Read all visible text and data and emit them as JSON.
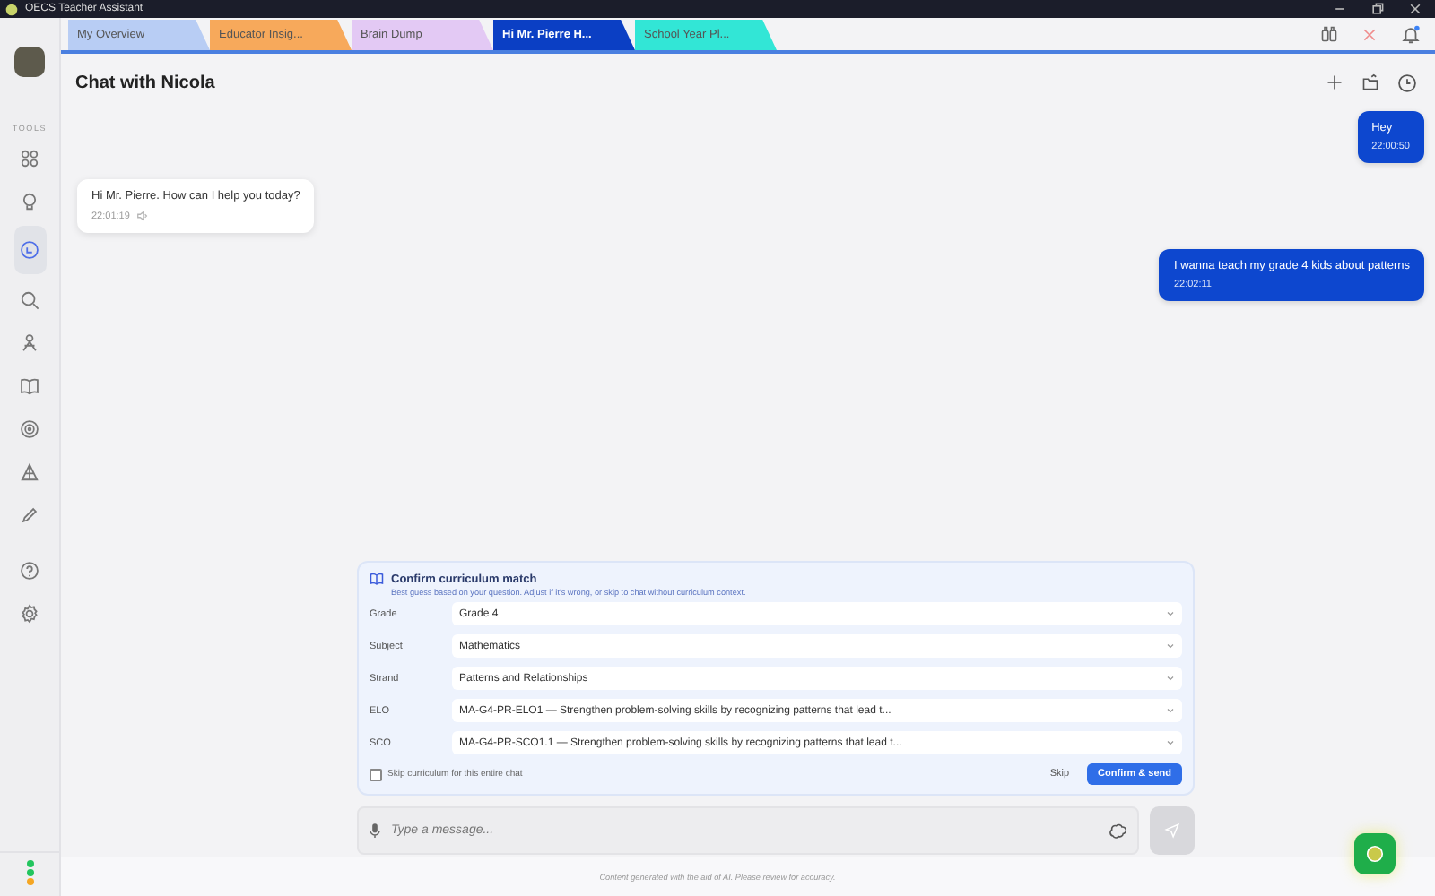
{
  "window": {
    "title": "OECS Teacher Assistant"
  },
  "tabs": [
    {
      "label": "My Overview",
      "selected": false,
      "color": "#b8cdf4"
    },
    {
      "label": "Educator Insig...",
      "selected": false,
      "color": "#f7a95b"
    },
    {
      "label": "Brain Dump",
      "selected": false,
      "color": "#e3c9f4"
    },
    {
      "label": "Hi Mr. Pierre H...",
      "selected": true,
      "color": "#0b3fc4"
    },
    {
      "label": "School Year Pl...",
      "selected": false,
      "color": "#32e6d6"
    }
  ],
  "sidebar": {
    "section_label": "TOOLS",
    "items": [
      {
        "selected": false
      },
      {
        "selected": false
      },
      {
        "selected": true
      },
      {
        "selected": false
      },
      {
        "selected": false
      },
      {
        "selected": false
      },
      {
        "selected": false
      },
      {
        "selected": false
      },
      {
        "selected": false
      },
      {
        "selected": false
      },
      {
        "selected": false
      }
    ],
    "status_dots": [
      {
        "color": "#22c55e"
      },
      {
        "color": "#22c55e"
      },
      {
        "color": "#f5a623"
      }
    ]
  },
  "chat": {
    "title": "Chat with Nicola",
    "messages": [
      {
        "kind": "user",
        "text": "Hey",
        "time": "22:00:50"
      },
      {
        "kind": "assistant",
        "text": "Hi Mr. Pierre. How can I help you today?",
        "time": "22:01:19"
      },
      {
        "kind": "user",
        "text": "I wanna teach my grade 4 kids about patterns",
        "time": "22:02:11"
      }
    ]
  },
  "curriculum_panel": {
    "title": "Confirm curriculum match",
    "subtitle": "Best guess based on your question. Adjust if it's wrong, or skip to chat without curriculum context.",
    "fields": [
      {
        "label": "Grade",
        "value": "Grade 4"
      },
      {
        "label": "Subject",
        "value": "Mathematics"
      },
      {
        "label": "Strand",
        "value": "Patterns and Relationships"
      },
      {
        "label": "ELO",
        "value": "MA-G4-PR-ELO1 — Strengthen problem-solving skills by recognizing patterns that lead t..."
      },
      {
        "label": "SCO",
        "value": "MA-G4-PR-SCO1.1 — Strengthen problem-solving skills by recognizing patterns that lead t..."
      }
    ],
    "skip_checkbox": {
      "label": "Skip curriculum for this entire chat",
      "checked": false
    },
    "buttons": {
      "skip": "Skip",
      "confirm": "Confirm & send"
    }
  },
  "composer": {
    "placeholder": "Type a message..."
  },
  "footer": "Content generated with the aid of AI. Please review for accuracy."
}
